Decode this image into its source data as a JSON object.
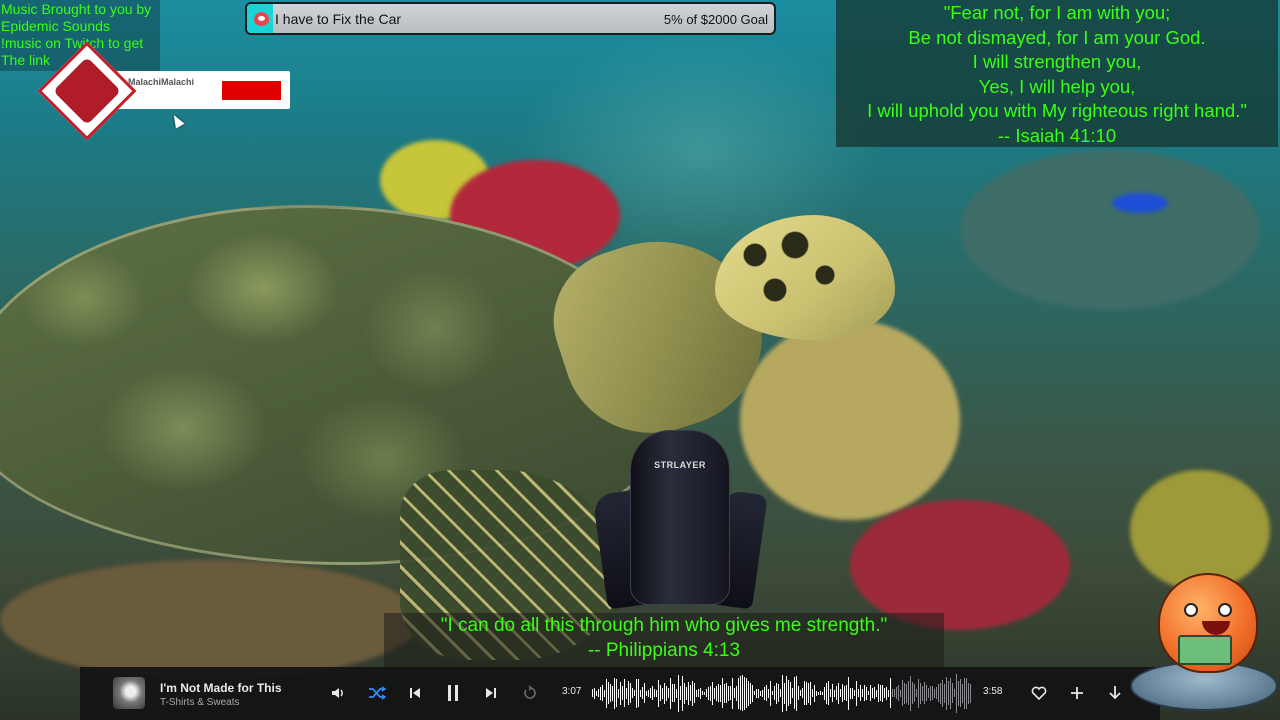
{
  "credit": {
    "line1": "Music Brought to you by",
    "line2": "Epidemic Sounds",
    "line3": "!music on Twitch to get",
    "line4": "The link"
  },
  "alert": {
    "username": "MalachiMalachi"
  },
  "goal": {
    "title": "I have to Fix the Car",
    "progress_text": "5% of $2000 Goal",
    "progress": 0.05,
    "fill_color": "#19d3d6"
  },
  "verse_top": {
    "lines": [
      "\"Fear not, for I am with you;",
      "Be not dismayed, for I am your God.",
      "I will strengthen you,",
      "Yes, I will help you,",
      "I will uphold you with My righteous right hand.\"",
      "-- Isaiah 41:10"
    ],
    "color": "#39ff14"
  },
  "chair": {
    "logo": "STRLAYER"
  },
  "verse_bottom": {
    "line1": "\"I can do all this through him who gives me strength.\"",
    "line2": "-- Philippians 4:13"
  },
  "player": {
    "track_title": "I'm Not Made for This",
    "artist": "T-Shirts & Sweats",
    "elapsed": "3:07",
    "duration": "3:58",
    "played_fraction": 0.785,
    "shuffle_active": true,
    "accent_color": "#2f8cff",
    "icons": {
      "volume": "volume-icon",
      "shuffle": "shuffle-icon",
      "previous": "previous-icon",
      "pause": "pause-icon",
      "next": "next-icon",
      "repeat": "repeat-icon",
      "like": "heart-icon",
      "add": "plus-icon",
      "download": "download-icon"
    }
  }
}
